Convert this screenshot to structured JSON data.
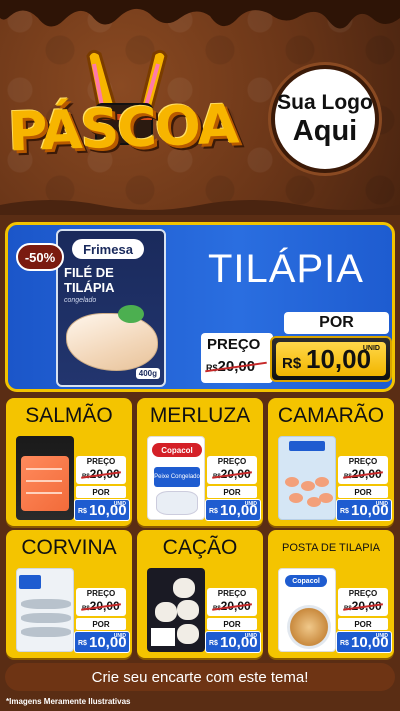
{
  "header": {
    "campaign_title": "PÁSCOA",
    "logo_placeholder": {
      "line1": "Sua Logo",
      "line2": "Aqui"
    }
  },
  "featured": {
    "discount": "-50%",
    "name": "TILÁPIA",
    "package": {
      "brand": "Frimesa",
      "title": "FILÉ DE TILÁPIA",
      "subtitle": "congelado",
      "weight": "400g"
    },
    "price_label": "PREÇO",
    "por_label": "POR",
    "currency": "R$",
    "old_price": "20,00",
    "unit": "UNID",
    "new_price": "10,00"
  },
  "products": [
    {
      "name": "SALMÃO",
      "price_label": "PREÇO",
      "currency": "R$",
      "old_price": "20,00",
      "por_label": "POR",
      "unit": "UNID",
      "new_price": "10,00"
    },
    {
      "name": "MERLUZA",
      "brand": "Copacol",
      "pack_label": "Peixe Congelado",
      "price_label": "PREÇO",
      "currency": "R$",
      "old_price": "20,00",
      "por_label": "POR",
      "unit": "UNID",
      "new_price": "10,00"
    },
    {
      "name": "CAMARÃO",
      "price_label": "PREÇO",
      "currency": "R$",
      "old_price": "20,00",
      "por_label": "POR",
      "unit": "UNID",
      "new_price": "10,00"
    },
    {
      "name": "CORVINA",
      "price_label": "PREÇO",
      "currency": "R$",
      "old_price": "20,00",
      "por_label": "POR",
      "unit": "UNID",
      "new_price": "10,00"
    },
    {
      "name": "CAÇÃO",
      "price_label": "PREÇO",
      "currency": "R$",
      "old_price": "20,00",
      "por_label": "POR",
      "unit": "UNID",
      "new_price": "10,00"
    },
    {
      "name": "POSTA DE TILAPIA",
      "brand": "Copacol",
      "price_label": "PREÇO",
      "currency": "R$",
      "old_price": "20,00",
      "por_label": "POR",
      "unit": "UNID",
      "new_price": "10,00"
    }
  ],
  "footer": {
    "cta": "Crie seu encarte com este tema!",
    "disclaimer": "*Imagens Meramente Ilustrativas"
  },
  "colors": {
    "chocolate": "#6b3618",
    "gold": "#f4c400",
    "blue": "#1e5cd0",
    "strike_red": "#c62828"
  }
}
